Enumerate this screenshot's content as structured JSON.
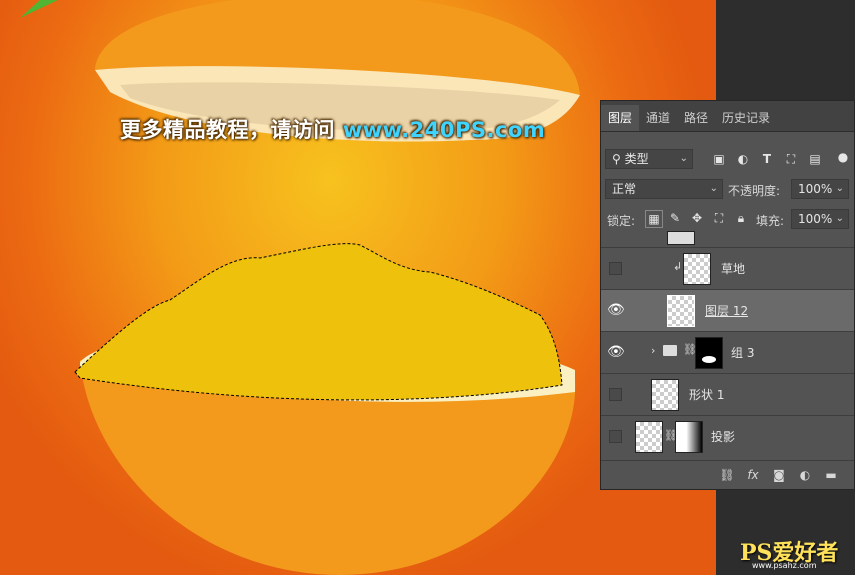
{
  "watermark": {
    "prefix": "更多精品教程，请访问",
    "url": "www.240PS.com"
  },
  "panel": {
    "tabs": [
      {
        "label": "图层",
        "active": true
      },
      {
        "label": "通道",
        "active": false
      },
      {
        "label": "路径",
        "active": false
      },
      {
        "label": "历史记录",
        "active": false
      }
    ],
    "filter_kind": "类型",
    "blend_mode": "正常",
    "opacity_label": "不透明度:",
    "opacity_value": "100%",
    "lock_label": "锁定:",
    "fill_label": "填充:",
    "fill_value": "100%",
    "layers": [
      {
        "name": "草地",
        "visible": false,
        "selected": false,
        "clipped": true
      },
      {
        "name": "图层 12",
        "visible": true,
        "selected": true
      },
      {
        "name": "组 3",
        "visible": true,
        "selected": false,
        "group": true
      },
      {
        "name": "形状 1",
        "visible": false,
        "selected": false
      },
      {
        "name": "投影",
        "visible": false,
        "selected": false
      }
    ],
    "bottom_icons": [
      "link-icon",
      "fx-icon",
      "mask-icon",
      "adjustment-icon",
      "folder-icon"
    ],
    "fx_label": "fx"
  },
  "logo": {
    "text": "PS爱好者",
    "url": "www.psahz.com"
  },
  "colors": {
    "canvas_bg": "#ec6a12",
    "orange_peel": "#f39a1c",
    "fill_yellow": "#eec20c",
    "url_blue": "#3fd3ff"
  }
}
